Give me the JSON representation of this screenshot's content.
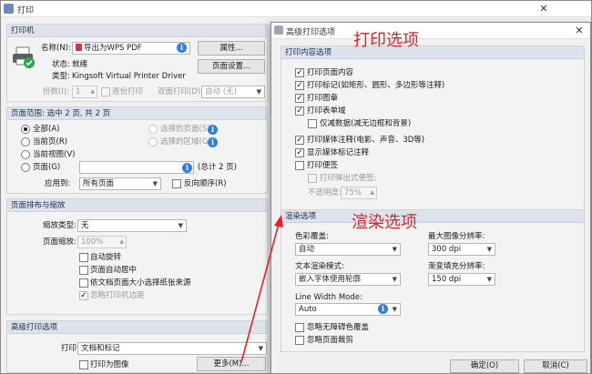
{
  "main_window": {
    "title": "打印",
    "printer": {
      "section": "打印机",
      "name_label": "名称(N):",
      "name_value": "导出为WPS PDF",
      "properties_button": "属性...",
      "status_label": "状态:",
      "status_value": "就绪",
      "type_label": "类型:",
      "type_value": "Kingsoft Virtual Printer Driver",
      "page_setup_button": "页面设置...",
      "copies_label": "份数(I):",
      "copies_value": "1",
      "collate_label": "逐份打印",
      "duplex_label": "双面打印(D)",
      "duplex_value": "自动 (无)"
    },
    "range": {
      "section": "页面范围: 选中 2 页, 共 2 页",
      "all_label": "全部(A)",
      "current_label": "当前页(R)",
      "current_view_label": "当前视图(V)",
      "pages_label": "页面(G)",
      "pages_count": "(总计 2 页)",
      "selected_pages_label": "选择的页面(S)",
      "selected_area_label": "选择的区域(G)",
      "apply_label": "应用到:",
      "apply_value": "所有页面",
      "reverse_label": "反向顺序(R)"
    },
    "layout": {
      "section": "页面排布与缩放",
      "zoom_type_label": "缩放类型:",
      "zoom_type_value": "无",
      "zoom_label": "页面缩放:",
      "zoom_value": "100%",
      "auto_rotate_label": "自动旋转",
      "auto_center_label": "页面自动居中",
      "paper_source_label": "依文档页面大小选择纸张来源",
      "ignore_margin_label": "忽略打印机边距"
    },
    "advanced": {
      "section": "高级打印选项",
      "print_label": "打印",
      "print_value": "文档和标记",
      "as_image_label": "打印为图像",
      "more_button": "更多(M)..."
    }
  },
  "adv_dialog": {
    "title": "高级打印选项",
    "content": {
      "section": "打印内容选项",
      "items": [
        {
          "label": "打印页面内容",
          "checked": true
        },
        {
          "label": "打印标记(如矩形、圆形、多边形等注释)",
          "checked": true
        },
        {
          "label": "打印图章",
          "checked": true
        },
        {
          "label": "打印表单域",
          "checked": true
        },
        {
          "label": "仅减数据(减无边框和背景)",
          "checked": false
        },
        {
          "label": "打印媒体注释(电影、声音、3D等)",
          "checked": true
        },
        {
          "label": "显示媒体标记注释",
          "checked": true
        },
        {
          "label": "打印便签",
          "checked": false
        }
      ],
      "popup_label": "打印弹出式便签:",
      "opacity_label": "不透明度:",
      "opacity_value": "75%"
    },
    "render": {
      "section": "渲染选项",
      "color_label": "色彩覆盖:",
      "color_value": "自动",
      "max_res_label": "最大图像分辨率:",
      "max_res_value": "300 dpi",
      "text_mode_label": "文本渲染模式:",
      "text_mode_value": "嵌入字体使用轮廓",
      "gradient_label": "渐变填充分辨率:",
      "gradient_value": "150 dpi",
      "line_width_label": "Line Width Mode:",
      "line_width_value": "Auto",
      "ignore_color_label": "忽略无障碍色覆盖",
      "ignore_crop_label": "忽略页面裁剪"
    },
    "ok_button": "确定(O)",
    "cancel_button": "取消(C)"
  },
  "annotations": {
    "print_options": "打印选项",
    "render_options": "渲染选项",
    "color": "#e0232b"
  }
}
